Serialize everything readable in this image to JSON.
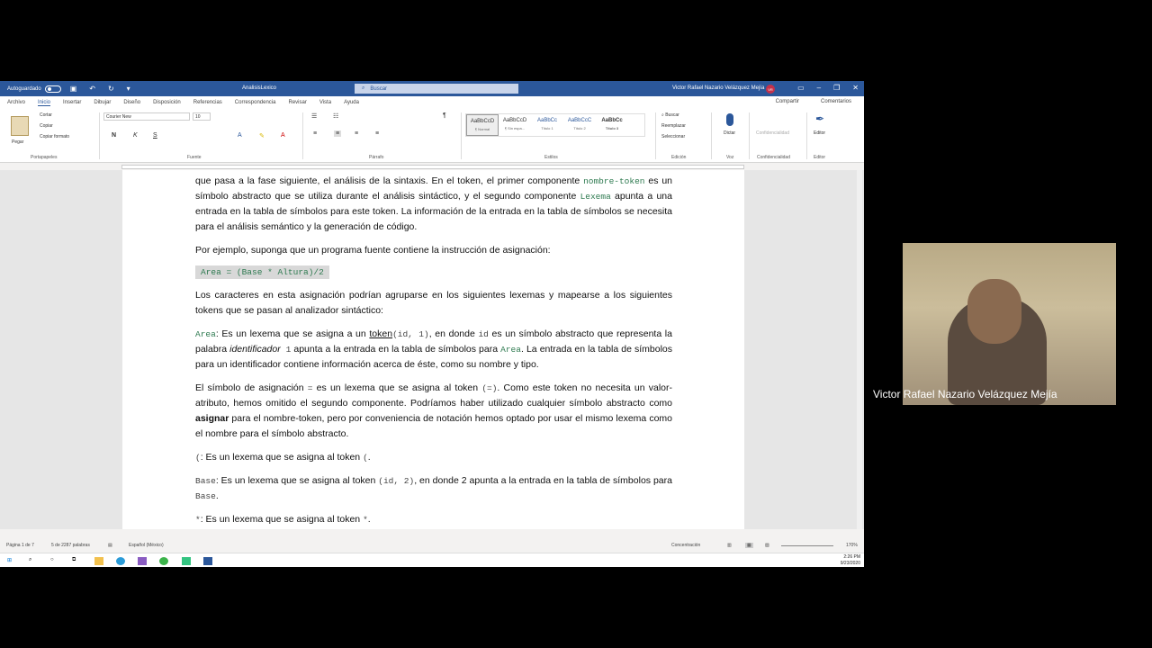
{
  "titlebar": {
    "autosave_label": "Autoguardado",
    "doc_title": "AnalisisLexico",
    "search_placeholder": "Buscar",
    "user_name": "Victor Rafael Nazario Velázquez Mejía",
    "user_initials": "VR"
  },
  "tabs": [
    "Archivo",
    "Inicio",
    "Insertar",
    "Dibujar",
    "Diseño",
    "Disposición",
    "Referencias",
    "Correspondencia",
    "Revisar",
    "Vista",
    "Ayuda"
  ],
  "tabs_right": {
    "share": "Compartir",
    "comments": "Comentarios"
  },
  "ribbon": {
    "clipboard": {
      "paste": "Pegar",
      "cut": "Cortar",
      "copy": "Copiar",
      "format_painter": "Copiar formato",
      "label": "Portapapeles"
    },
    "font": {
      "name": "Courier New",
      "size": "10",
      "label": "Fuente"
    },
    "paragraph": {
      "label": "Párrafo"
    },
    "styles": {
      "items": [
        {
          "sample": "AaBbCcD",
          "name": "¶ Normal"
        },
        {
          "sample": "AaBbCcD",
          "name": "¶ Sin espa..."
        },
        {
          "sample": "AaBbCc",
          "name": "Título 1"
        },
        {
          "sample": "AaBbCcC",
          "name": "Título 2"
        },
        {
          "sample": "AaBbCc",
          "name": "Título 3"
        }
      ],
      "label": "Estilos"
    },
    "editing": {
      "find": "Buscar",
      "replace": "Reemplazar",
      "select": "Seleccionar",
      "label": "Edición"
    },
    "voice": {
      "dictate": "Dictar",
      "label": "Voz"
    },
    "sensitivity": {
      "name": "Confidencialidad",
      "label": "Confidencialidad"
    },
    "editor": {
      "name": "Editor",
      "label": "Editor"
    }
  },
  "document": {
    "p1_a": "que pasa a la fase siguiente, el análisis de la sintaxis. En el token, el primer componente ",
    "p1_code1": "nombre-token",
    "p1_b": " es un símbolo abstracto que se utiliza durante el análisis sintáctico, y el segundo componente ",
    "p1_code2": "Lexema",
    "p1_c": " apunta a una entrada en la tabla de símbolos para este token. La información de la entrada en la tabla de símbolos se necesita para el análisis semántico y la generación de código.",
    "p2": "Por ejemplo, suponga que un programa fuente contiene la instrucción de asignación:",
    "code_line": "Area = (Base * Altura)/2",
    "p3": "Los caracteres en esta asignación podrían agruparse en los siguientes lexemas y mapearse a los siguientes tokens que se pasan al analizador sintáctico:",
    "p4_code": "Area",
    "p4_a": ": Es un lexema que se asigna a un ",
    "p4_token": "token",
    "p4_code2": "(id,  1)",
    "p4_b": ", en donde ",
    "p4_id": "id",
    "p4_c": " es un símbolo abstracto que representa la palabra ",
    "p4_ident": "identificador",
    "p4_one": " 1",
    "p4_d": " apunta a la entrada en la tabla de símbolos para ",
    "p4_area": "Area",
    "p4_e": ". La entrada en la tabla de símbolos para un identificador contiene información acerca de éste, como su nombre y tipo.",
    "p5_a": "El símbolo de asignación ",
    "p5_eq": "=",
    "p5_b": " es un lexema que se asigna al token ",
    "p5_eq2": "(=)",
    "p5_c": ". Como este token no necesita un valor-atributo, hemos omitido el segundo componente. Podríamos haber utilizado cualquier símbolo abstracto como ",
    "p5_bold": "asignar",
    "p5_d": " para el nombre-token, pero por conveniencia de notación hemos optado por usar el mismo lexema como el nombre para el símbolo abstracto.",
    "p6_code": "(",
    "p6_a": ": Es un lexema que se asigna al token ",
    "p6_code2": "(",
    "p6_end": ".",
    "p7_code": "Base",
    "p7_a": ": Es un lexema que se asigna al token ",
    "p7_code2": "(id, 2)",
    "p7_b": ", en donde 2 apunta a la entrada en la tabla de símbolos para ",
    "p7_code3": "Base",
    "p7_end": ".",
    "p8_code": "*",
    "p8_a": ": Es un lexema que se asigna al token ",
    "p8_code2": "*",
    "p8_end": "."
  },
  "status": {
    "page": "Página 1 de 7",
    "words": "5 de 2287 palabras",
    "language": "Español (México)",
    "focus": "Concentración",
    "zoom": "170%"
  },
  "taskbar": {
    "time": "2:26 PM",
    "date": "9/23/2020"
  },
  "webcam": {
    "name": "Victor Rafael Nazario Velázquez Mejía"
  }
}
